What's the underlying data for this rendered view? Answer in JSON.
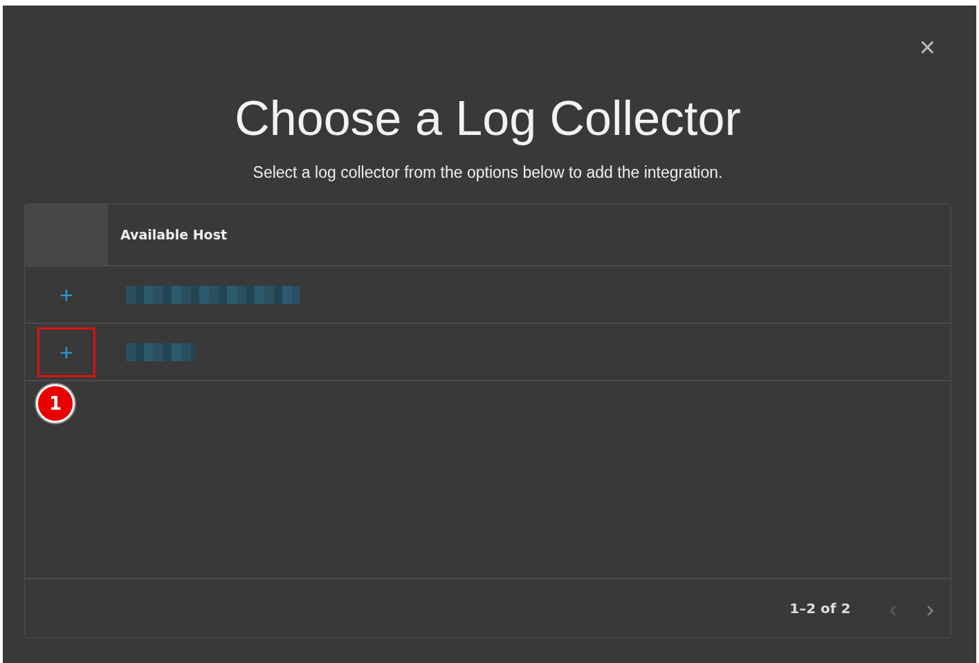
{
  "dialog": {
    "close_icon": "×",
    "title": "Choose a Log Collector",
    "subtitle": "Select a log collector from the options below to add the integration."
  },
  "table": {
    "columns": [
      {
        "label": "Available Host"
      }
    ],
    "rows": [
      {
        "add_icon": "+",
        "highlighted": false
      },
      {
        "add_icon": "+",
        "highlighted": true
      }
    ],
    "callout": {
      "label": "1"
    },
    "pagination": {
      "range": "1–2 of 2",
      "prev": {
        "icon": "‹",
        "disabled": true
      },
      "next": {
        "icon": "›",
        "disabled": false
      }
    }
  }
}
